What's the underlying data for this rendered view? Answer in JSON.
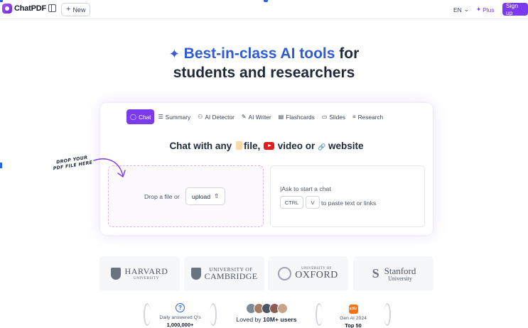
{
  "header": {
    "brand": "ChatPDF",
    "new_label": "New",
    "language": "EN",
    "plus_label": "Plus",
    "signup_label": "Sign up"
  },
  "hero": {
    "accent_text": "Best-in-class AI tools",
    "line1_rest": "for",
    "line2": "students and researchers"
  },
  "tabs": [
    {
      "label": "Chat",
      "icon": "chat-bubble-icon",
      "active": true
    },
    {
      "label": "Summary",
      "icon": "list-icon"
    },
    {
      "label": "AI Detector",
      "icon": "detector-icon"
    },
    {
      "label": "AI Writer",
      "icon": "pen-icon"
    },
    {
      "label": "Flashcards",
      "icon": "cards-icon"
    },
    {
      "label": "Slides",
      "icon": "slides-icon"
    },
    {
      "label": "Research",
      "icon": "research-icon"
    }
  ],
  "chat_with": {
    "prefix": "Chat with any",
    "file": "file,",
    "video": "video or",
    "website": "website"
  },
  "upload": {
    "drop_text": "Drop a file or",
    "button_label": "upload"
  },
  "chat_input": {
    "placeholder": "Ask to start a chat",
    "key_ctrl": "CTRL",
    "key_v": "V",
    "paste_hint": "to paste text or links"
  },
  "drop_note": {
    "line1": "DROP YOUR",
    "line2": "PDF FILE HERE"
  },
  "universities": {
    "harvard": {
      "name": "HARVARD",
      "sub": "UNIVERSITY"
    },
    "cambridge": {
      "line1": "UNIVERSITY OF",
      "line2": "CAMBRIDGE"
    },
    "oxford": {
      "line1": "UNIVERSITY OF",
      "line2": "OXFORD"
    },
    "stanford": {
      "line1": "Stanford",
      "line2": "University"
    }
  },
  "stats": {
    "questions_label": "Daily answered Q's",
    "questions_value": "1,000,000+",
    "loved_prefix": "Loved by",
    "loved_value": "10M+ users",
    "g2_label": "Gen AI 2024",
    "g2_value": "Top 50",
    "g2_badge": "a16z"
  },
  "colors": {
    "brand": "#7c3aed",
    "accent_blue": "#2f5bd6"
  }
}
